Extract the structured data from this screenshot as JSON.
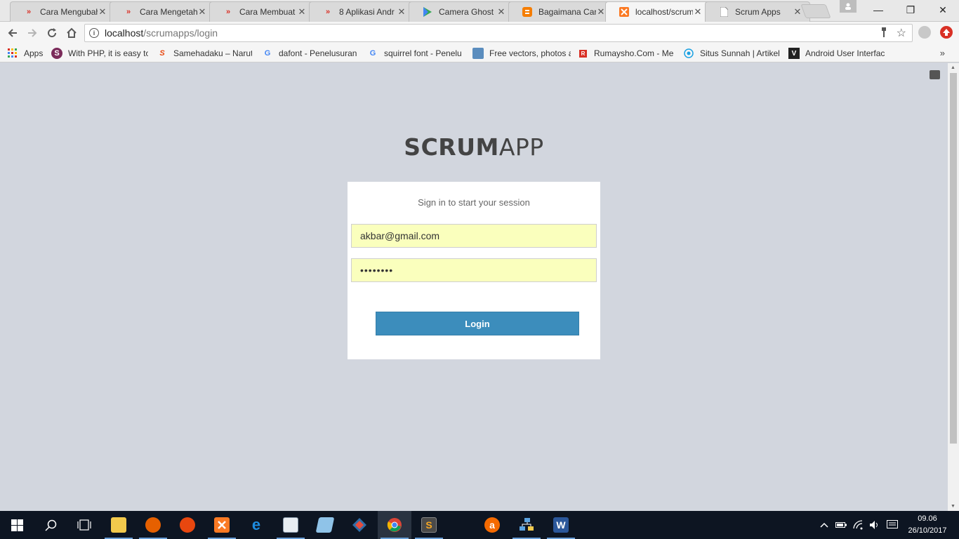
{
  "browser": {
    "tabs": [
      {
        "title": "Cara Mengubah",
        "icon": "double-chevron-icon",
        "color": "#d93025",
        "active": false
      },
      {
        "title": "Cara Mengetahui",
        "icon": "double-chevron-icon",
        "color": "#d93025",
        "active": false
      },
      {
        "title": "Cara Membuat",
        "icon": "double-chevron-icon",
        "color": "#d93025",
        "active": false
      },
      {
        "title": "8 Aplikasi Andr",
        "icon": "double-chevron-icon",
        "color": "#d93025",
        "active": false
      },
      {
        "title": "Camera Ghost",
        "icon": "play-store-icon",
        "color": "#34a853",
        "active": false
      },
      {
        "title": "Bagaimana Car",
        "icon": "blogger-icon",
        "color": "#f57d00",
        "active": false
      },
      {
        "title": "localhost/scrum",
        "icon": "xampp-icon",
        "color": "#fb7a24",
        "active": true
      },
      {
        "title": "Scrum Apps",
        "icon": "page-icon",
        "color": "#888888",
        "active": false
      }
    ],
    "tab_close_glyph": "✕",
    "window_controls": {
      "minimize": "—",
      "restore": "❐",
      "close": "✕"
    },
    "url_host": "localhost",
    "url_path": "/scrumapps/login",
    "bookmarks": [
      {
        "label": "Apps",
        "icon": "apps-grid-icon"
      },
      {
        "label": "With PHP, it is easy to",
        "icon": "php-site-icon"
      },
      {
        "label": "Samehadaku – Naruto",
        "icon": "samehadaku-icon"
      },
      {
        "label": "dafont - Penelusuran",
        "icon": "google-icon"
      },
      {
        "label": "squirrel font - Penelu",
        "icon": "google-icon"
      },
      {
        "label": "Free vectors, photos a",
        "icon": "freepik-icon"
      },
      {
        "label": "Rumaysho.Com - Me",
        "icon": "rumaysho-icon"
      },
      {
        "label": "Situs Sunnah | Artikel",
        "icon": "sunnah-icon"
      },
      {
        "label": "Android User Interfac",
        "icon": "v-icon"
      }
    ],
    "bookmarks_more": "»"
  },
  "page": {
    "logo_bold": "SCRUM",
    "logo_light": "APP",
    "login_message": "Sign in to start your session",
    "email_value": "akbar@gmail.com",
    "password_value": "••••••••",
    "login_button": "Login",
    "background_color": "#d2d6de",
    "button_color": "#3c8dbc",
    "autofill_color": "#faffbd"
  },
  "taskbar": {
    "apps": [
      {
        "name": "file-explorer",
        "icon": "folder-icon"
      },
      {
        "name": "firefox",
        "icon": "firefox-icon"
      },
      {
        "name": "filezilla",
        "icon": "filezilla-icon"
      },
      {
        "name": "xampp",
        "icon": "xampp-icon"
      },
      {
        "name": "edge",
        "icon": "edge-icon"
      },
      {
        "name": "notepad",
        "icon": "notepad-icon"
      },
      {
        "name": "virtualbox",
        "icon": "box-icon"
      },
      {
        "name": "git",
        "icon": "git-icon"
      },
      {
        "name": "chrome",
        "icon": "chrome-icon"
      },
      {
        "name": "sublime",
        "icon": "sublime-icon"
      },
      {
        "name": "avast",
        "icon": "avast-icon"
      },
      {
        "name": "network-tool",
        "icon": "network-icon"
      },
      {
        "name": "word",
        "icon": "word-icon"
      }
    ],
    "time": "09.06",
    "date": "26/10/2017"
  }
}
